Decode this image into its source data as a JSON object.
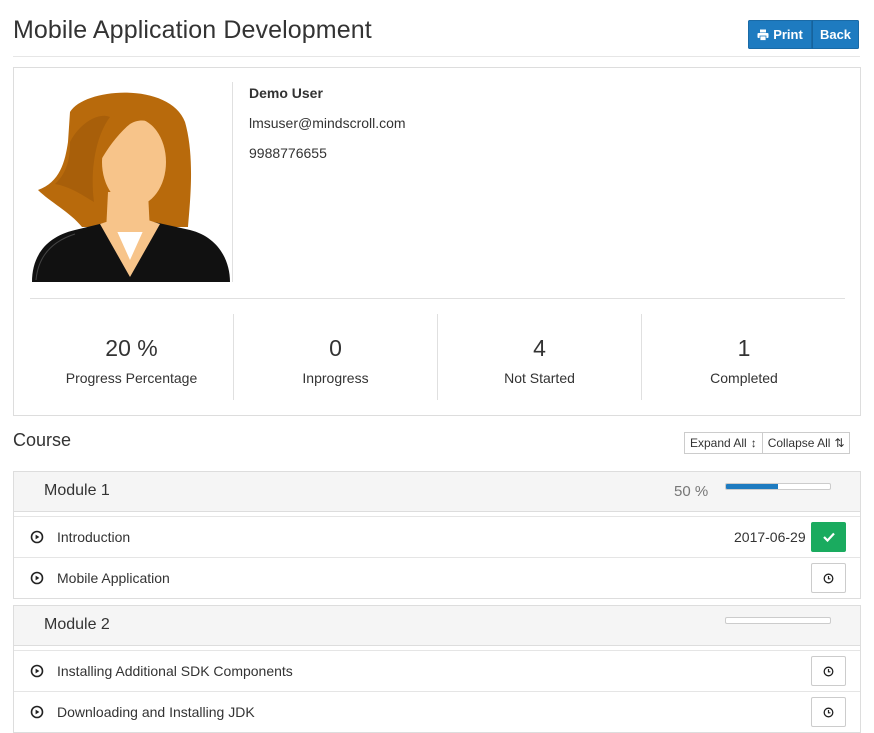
{
  "page": {
    "title": "Mobile Application Development"
  },
  "toolbar": {
    "print_label": "Print",
    "back_label": "Back",
    "print_icon": "print-icon"
  },
  "user": {
    "name": "Demo User",
    "email": "lmsuser@mindscroll.com",
    "phone": "9988776655",
    "avatar": "female-avatar"
  },
  "stats": [
    {
      "value": "20 %",
      "label": "Progress Percentage"
    },
    {
      "value": "0",
      "label": "Inprogress"
    },
    {
      "value": "4",
      "label": "Not Started"
    },
    {
      "value": "1",
      "label": "Completed"
    }
  ],
  "course": {
    "title": "Course",
    "expand_all_label": "Expand All",
    "collapse_all_label": "Collapse All"
  },
  "modules": [
    {
      "title": "Module 1",
      "percent_label": "50 %",
      "progress": 0.5,
      "lessons": [
        {
          "title": "Introduction",
          "date": "2017-06-29",
          "status": "completed"
        },
        {
          "title": "Mobile Application",
          "date": "",
          "status": "not-started"
        }
      ]
    },
    {
      "title": "Module 2",
      "percent_label": "",
      "progress": 0,
      "lessons": [
        {
          "title": "Installing Additional SDK Components",
          "date": "",
          "status": "not-started"
        },
        {
          "title": "Downloading and Installing JDK",
          "date": "",
          "status": "not-started"
        }
      ]
    }
  ],
  "colors": {
    "accent": "#1e7bc0",
    "success": "#1aab5f",
    "header_bg": "#f5f5f5",
    "border": "#dddddd"
  }
}
